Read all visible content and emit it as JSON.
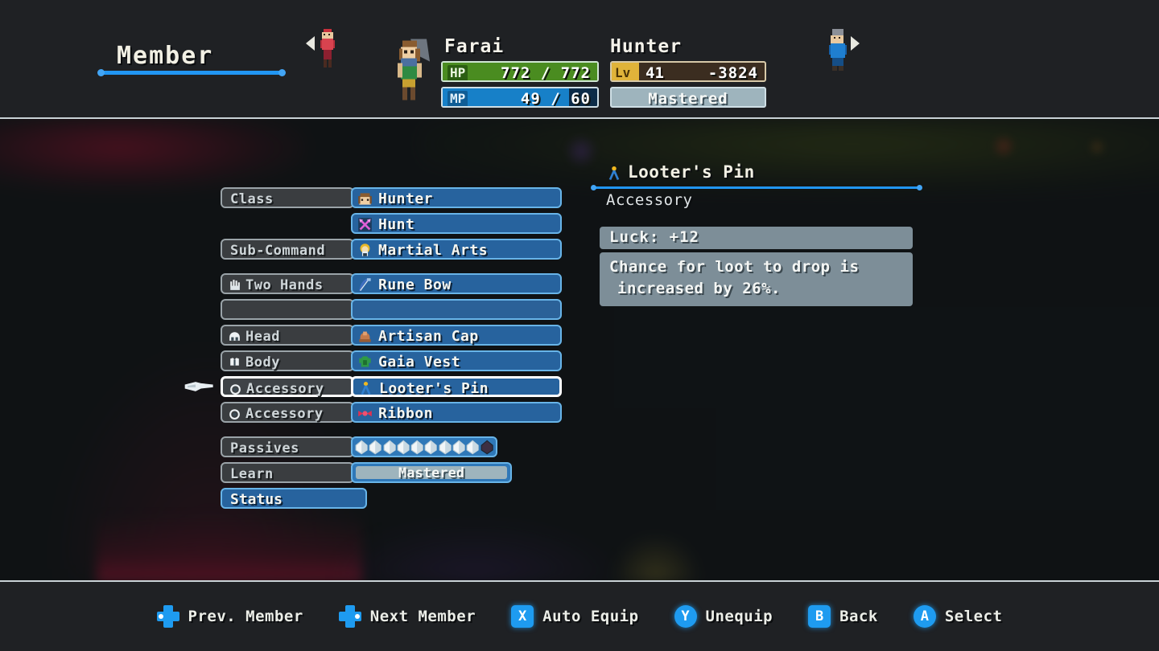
{
  "header": {
    "title": "Member",
    "nav_prev_icon": "arrow-left-icon",
    "nav_next_icon": "arrow-right-icon",
    "character": {
      "name": "Farai",
      "class": "Hunter",
      "hp_label": "HP",
      "hp_value": "772 / 772",
      "hp_percent": 100,
      "mp_label": "MP",
      "mp_value": "49 / 60",
      "mp_percent": 82,
      "lv_label": "Lv",
      "lv_value": "41",
      "exp_value": "-3824",
      "job_status": "Mastered"
    }
  },
  "equipment": {
    "rows": [
      {
        "slot": "Class",
        "slot_icon": "",
        "value": "Hunter",
        "value_icon": "hunter-face-icon",
        "selected": false,
        "gap": false
      },
      {
        "slot": "",
        "slot_icon": "",
        "value": "Hunt",
        "value_icon": "crossed-arrows-icon",
        "selected": false,
        "gap": false
      },
      {
        "slot": "Sub-Command",
        "slot_icon": "",
        "value": "Martial Arts",
        "value_icon": "martial-arts-icon",
        "selected": false,
        "gap": true
      },
      {
        "slot": "Two Hands",
        "slot_icon": "hand-icon",
        "value": "Rune Bow",
        "value_icon": "bow-icon",
        "selected": false,
        "gap": false
      },
      {
        "slot": "",
        "slot_icon": "",
        "value": "",
        "value_icon": "",
        "selected": false,
        "gap": false
      },
      {
        "slot": "Head",
        "slot_icon": "helmet-icon",
        "value": "Artisan Cap",
        "value_icon": "cap-icon",
        "selected": false,
        "gap": false
      },
      {
        "slot": "Body",
        "slot_icon": "armor-icon",
        "value": "Gaia Vest",
        "value_icon": "vest-icon",
        "selected": false,
        "gap": false
      },
      {
        "slot": "Accessory",
        "slot_icon": "ring-icon",
        "value": "Looter's Pin",
        "value_icon": "pin-icon",
        "selected": true,
        "gap": false
      },
      {
        "slot": "Accessory",
        "slot_icon": "ring-icon",
        "value": "Ribbon",
        "value_icon": "ribbon-icon",
        "selected": false,
        "gap": true
      }
    ],
    "passives_label": "Passives",
    "passives_filled": 9,
    "passives_empty": 1,
    "learn_label": "Learn",
    "learn_value": "Mastered",
    "status_label": "Status",
    "cursor_icon": "pointing-hand-cursor"
  },
  "detail": {
    "icon": "pin-icon",
    "name": "Looter's Pin",
    "type": "Accessory",
    "stat": "Luck:  +12",
    "description_line1": "Chance for loot to drop is",
    "description_line2": "increased by 26%."
  },
  "footer": {
    "buttons": [
      {
        "icon": "dpad-left-icon",
        "label": "Prev. Member"
      },
      {
        "icon": "dpad-right-icon",
        "label": "Next Member"
      },
      {
        "icon": "x-button-icon",
        "label": "Auto Equip",
        "glyph": "X"
      },
      {
        "icon": "y-button-icon",
        "label": "Unequip",
        "glyph": "Y"
      },
      {
        "icon": "b-button-icon",
        "label": "Back",
        "glyph": "B"
      },
      {
        "icon": "a-button-icon",
        "label": "Select",
        "glyph": "A"
      }
    ]
  },
  "colors": {
    "accent_blue": "#2196f3",
    "panel_blue": "#27639e",
    "border_blue": "#68b4e8",
    "hp_green": "#4a8c20",
    "mp_blue": "#1780c8",
    "lv_gold": "#e0b33a",
    "stat_gray": "#7d8e98",
    "text_light": "#f2f0e4"
  }
}
